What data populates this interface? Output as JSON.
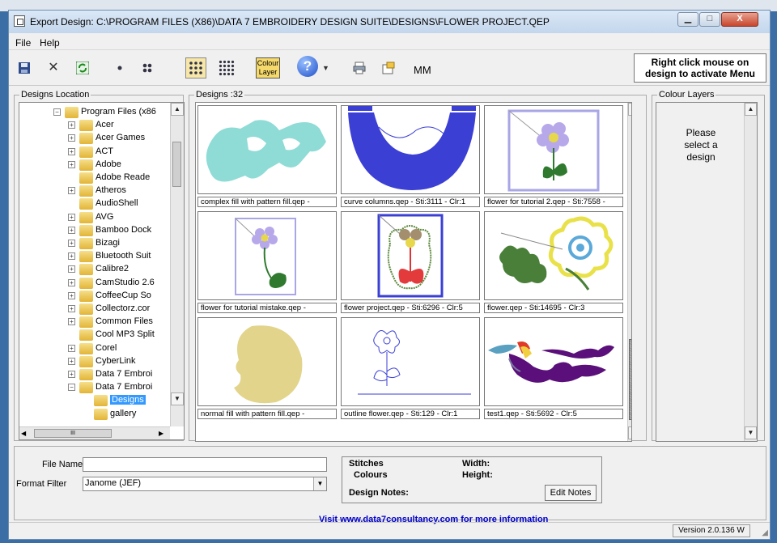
{
  "window": {
    "title": "Export Design: C:\\PROGRAM FILES (X86)\\DATA 7 EMBROIDERY DESIGN SUITE\\DESIGNS\\FLOWER PROJECT.QEP",
    "min": "▁",
    "max": "□",
    "close": "X"
  },
  "menu": [
    "File",
    "Help"
  ],
  "toolbar": {
    "save_icon": "floppy-disk-icon",
    "cancel": "✕",
    "refresh_icon": "refresh-icon",
    "colour_label": "Colour Layer",
    "help": "?",
    "help_caret": "▼",
    "mm": "MM"
  },
  "right_click_hint": "Right click mouse on design to activate Menu",
  "designs_location": {
    "title": "Designs Location",
    "items": [
      {
        "label": "Program Files (x86",
        "expanded": true,
        "indent": 1,
        "pm": "-"
      },
      {
        "label": "Acer",
        "indent": 2,
        "pm": "+"
      },
      {
        "label": "Acer Games",
        "indent": 2,
        "pm": "+"
      },
      {
        "label": "ACT",
        "indent": 2,
        "pm": "+"
      },
      {
        "label": "Adobe",
        "indent": 2,
        "pm": "+"
      },
      {
        "label": "Adobe Reade",
        "indent": 2,
        "pm": ""
      },
      {
        "label": "Atheros",
        "indent": 2,
        "pm": "+"
      },
      {
        "label": "AudioShell",
        "indent": 2,
        "pm": ""
      },
      {
        "label": "AVG",
        "indent": 2,
        "pm": "+"
      },
      {
        "label": "Bamboo Dock",
        "indent": 2,
        "pm": "+"
      },
      {
        "label": "Bizagi",
        "indent": 2,
        "pm": "+"
      },
      {
        "label": "Bluetooth Suit",
        "indent": 2,
        "pm": "+"
      },
      {
        "label": "Calibre2",
        "indent": 2,
        "pm": "+"
      },
      {
        "label": "CamStudio 2.6",
        "indent": 2,
        "pm": "+"
      },
      {
        "label": "CoffeeCup So",
        "indent": 2,
        "pm": "+"
      },
      {
        "label": "Collectorz.cor",
        "indent": 2,
        "pm": "+"
      },
      {
        "label": "Common Files",
        "indent": 2,
        "pm": "+"
      },
      {
        "label": "Cool MP3 Split",
        "indent": 2,
        "pm": ""
      },
      {
        "label": "Corel",
        "indent": 2,
        "pm": "+"
      },
      {
        "label": "CyberLink",
        "indent": 2,
        "pm": "+"
      },
      {
        "label": "Data 7 Embroi",
        "indent": 2,
        "pm": "+"
      },
      {
        "label": "Data 7 Embroi",
        "indent": 2,
        "pm": "-"
      },
      {
        "label": "Designs",
        "indent": 3,
        "pm": "",
        "selected": true
      },
      {
        "label": "gallery",
        "indent": 3,
        "pm": ""
      }
    ],
    "hscroll_grip": "III"
  },
  "designs": {
    "title": "Designs :32",
    "items": [
      {
        "caption": "complex fill with pattern fill.qep -"
      },
      {
        "caption": "curve columns.qep - Sti:3111 - Clr:1"
      },
      {
        "caption": "flower for tutorial 2.qep - Sti:7558 -"
      },
      {
        "caption": "flower for tutorial mistake.qep -"
      },
      {
        "caption": "flower project.qep - Sti:6296 - Clr:5"
      },
      {
        "caption": "flower.qep - Sti:14695 - Clr:3"
      },
      {
        "caption": "normal fill with pattern fill.qep -"
      },
      {
        "caption": "outline flower.qep - Sti:129 - Clr:1"
      },
      {
        "caption": "test1.qep - Sti:5692 - Clr:5"
      }
    ]
  },
  "colour_layers": {
    "title": "Colour Layers",
    "message_lines": [
      "Please",
      "select a",
      "design"
    ]
  },
  "bottom": {
    "file_name_label": "File Name",
    "file_name_value": "",
    "format_filter_label": "Format Filter",
    "format_filter_value": "Janome (JEF)",
    "stitches_label": "Stitches",
    "colours_label": "Colours",
    "width_label": "Width:",
    "height_label": "Height:",
    "design_notes_label": "Design Notes:",
    "edit_notes": "Edit Notes",
    "visit": "Visit www.data7consultancy.com for more information"
  },
  "status": {
    "version": "Version 2.0.136 W"
  }
}
